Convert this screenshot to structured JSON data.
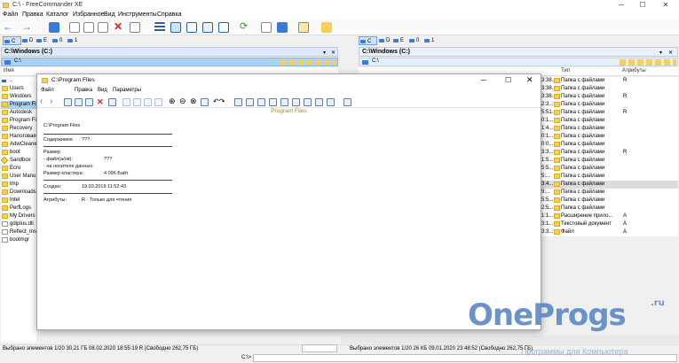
{
  "app": {
    "title": "C:\\ - FreeCommander XE"
  },
  "window_controls": [
    "─",
    "☐",
    "✕"
  ],
  "menu": [
    "Файл",
    "Правка",
    "Каталог",
    "Избранное",
    "Вид",
    "Инструменты",
    "Справка"
  ],
  "left_panel": {
    "drives": [
      "C",
      "D",
      "E",
      "0",
      "1"
    ],
    "active_drive": "C",
    "tab_path": "C:\\Windows (C:)",
    "current_path": "C:\\",
    "col_name": "Имя",
    "up_item": "..",
    "items": [
      {
        "name": "Users",
        "icon": "folder"
      },
      {
        "name": "Windows",
        "icon": "folder"
      },
      {
        "name": "Program Fi",
        "icon": "folder",
        "selected": true
      },
      {
        "name": "Autodesk",
        "icon": "folder"
      },
      {
        "name": "Program Fi",
        "icon": "folder"
      },
      {
        "name": "Recovery",
        "icon": "folder"
      },
      {
        "name": "Налоговая",
        "icon": "folder"
      },
      {
        "name": "AdwCleane",
        "icon": "folder"
      },
      {
        "name": "boot",
        "icon": "folder"
      },
      {
        "name": "Sandbox",
        "icon": "sandbox"
      },
      {
        "name": "Ecru",
        "icon": "folder"
      },
      {
        "name": "User Manu",
        "icon": "folder"
      },
      {
        "name": "tmp",
        "icon": "folder"
      },
      {
        "name": "Downloads",
        "icon": "folder"
      },
      {
        "name": "Intel",
        "icon": "folder"
      },
      {
        "name": "PerfLogs",
        "icon": "folder"
      },
      {
        "name": "My Drivers",
        "icon": "folder"
      },
      {
        "name": "gdiplus.dll",
        "icon": "file"
      },
      {
        "name": "Reflect_Ins",
        "icon": "file"
      },
      {
        "name": "bootmgr",
        "icon": "file"
      }
    ],
    "status": "Выбрано элементов 1/20    30,21 ГБ    08.02.2020  18:55:19    R    (Свободно 262,75 ГБ)"
  },
  "right_panel": {
    "drives": [
      "C",
      "D",
      "E",
      "0",
      "1"
    ],
    "active_drive": "C",
    "tab_path": "C:\\Windows (C:)",
    "current_path": "C:\\",
    "col_type": "Тип",
    "col_attr": "Атрибуты",
    "rows": [
      {
        "time": "3:38...",
        "type": "Папка с файлами",
        "attr": "R"
      },
      {
        "time": "3:38...",
        "type": "Папка с файлами",
        "attr": ""
      },
      {
        "time": "3:38...",
        "type": "Папка с файлами",
        "attr": "R"
      },
      {
        "time": "2:3...",
        "type": "Папка с файлами",
        "attr": ""
      },
      {
        "time": "5:51...",
        "type": "Папка с файлами",
        "attr": "R"
      },
      {
        "time": "0:1...",
        "type": "Папка с файлами",
        "attr": ""
      },
      {
        "time": "1:4...",
        "type": "Папка с файлами",
        "attr": ""
      },
      {
        "time": "0:1...",
        "type": "Папка с файлами",
        "attr": ""
      },
      {
        "time": "0:0...",
        "type": "Папка с файлами",
        "attr": ""
      },
      {
        "time": "3:3...",
        "type": "Папка с файлами",
        "attr": "R"
      },
      {
        "time": "1:5...",
        "type": "Папка с файлами",
        "attr": ""
      },
      {
        "time": "5:5...",
        "type": "Папка с файлами",
        "attr": ""
      },
      {
        "time": "5:...",
        "type": "Папка с файлами",
        "attr": ""
      },
      {
        "time": "3:4...",
        "type": "Папка с файлами",
        "attr": "",
        "selected": true
      },
      {
        "time": "9:...",
        "type": "Папка с файлами",
        "attr": ""
      },
      {
        "time": "5:5...",
        "type": "Папка с файлами",
        "attr": ""
      },
      {
        "time": "2:5...",
        "type": "Папка с файлами",
        "attr": ""
      },
      {
        "time": "1:1...",
        "type": "Расширение прило...",
        "attr": "A"
      },
      {
        "time": "3:1...",
        "type": "Текстовый документ",
        "attr": "A"
      },
      {
        "time": "3:3...",
        "type": "Файл",
        "attr": "A"
      }
    ],
    "status": "Выбрано элементов 1/20    26 КБ    09.01.2020  23:48:52    (Свободно 262,75 ГБ)"
  },
  "cmdline": {
    "prompt": "C:\\>"
  },
  "dialog": {
    "title": "C:\\Program Files",
    "menu": [
      "Файл",
      "Правка",
      "Вид",
      "Параметры"
    ],
    "heading": "Program Files",
    "path": "C:\\Program Files",
    "content_label": "Содержимое",
    "content_value": "???",
    "size_label": "Размер",
    "files_label": "- файл(а/ов):",
    "files_value": "???",
    "disk_label": "- на носителе данных:",
    "disk_value": "",
    "cluster_label": "Размер кластера:",
    "cluster_value": "4 096 Байт",
    "created_label": "Создан:",
    "created_value": "19.03.2019 11:52:43",
    "attrs_label": "Атрибуты:",
    "attrs_value": "R - Только для чтения"
  },
  "watermark": {
    "brand": "OneProgs",
    "tld": ".ru",
    "subtitle": "Программы для Компьютера"
  },
  "colors": {
    "accent": "#3a7bd5",
    "selection": "#a9d2f5",
    "folder": "#f3cf5c",
    "heading": "#9a8a2a",
    "logo": "#5b88c6"
  }
}
